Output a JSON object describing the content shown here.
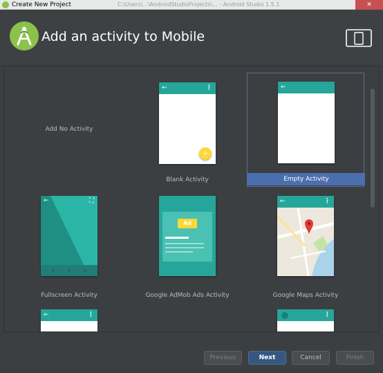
{
  "window": {
    "title": "Create New Project",
    "path": "C:\\Users\\...\\AndroidStudioProjects\\...  - Android Studio 1.5.1",
    "close_label": "✕"
  },
  "header": {
    "title": "Add an activity to Mobile"
  },
  "gallery": {
    "tiles": [
      {
        "label": "Add No Activity"
      },
      {
        "label": "Blank Activity"
      },
      {
        "label": "Empty Activity"
      },
      {
        "label": "Fullscreen Activity"
      },
      {
        "label": "Google AdMob Ads Activity",
        "ad_badge": "Ad"
      },
      {
        "label": "Google Maps Activity"
      }
    ]
  },
  "glyphs": {
    "back": "←",
    "more": "⋮",
    "plus": "+",
    "fullscreen": "⛶"
  },
  "footer": {
    "previous": "Previous",
    "next": "Next",
    "cancel": "Cancel",
    "finish": "Finish"
  },
  "colors": {
    "accent_teal": "#26a69a",
    "selection": "#4b6eaf",
    "fab_yellow": "#fdd835",
    "logo_green": "#8bc34a"
  }
}
